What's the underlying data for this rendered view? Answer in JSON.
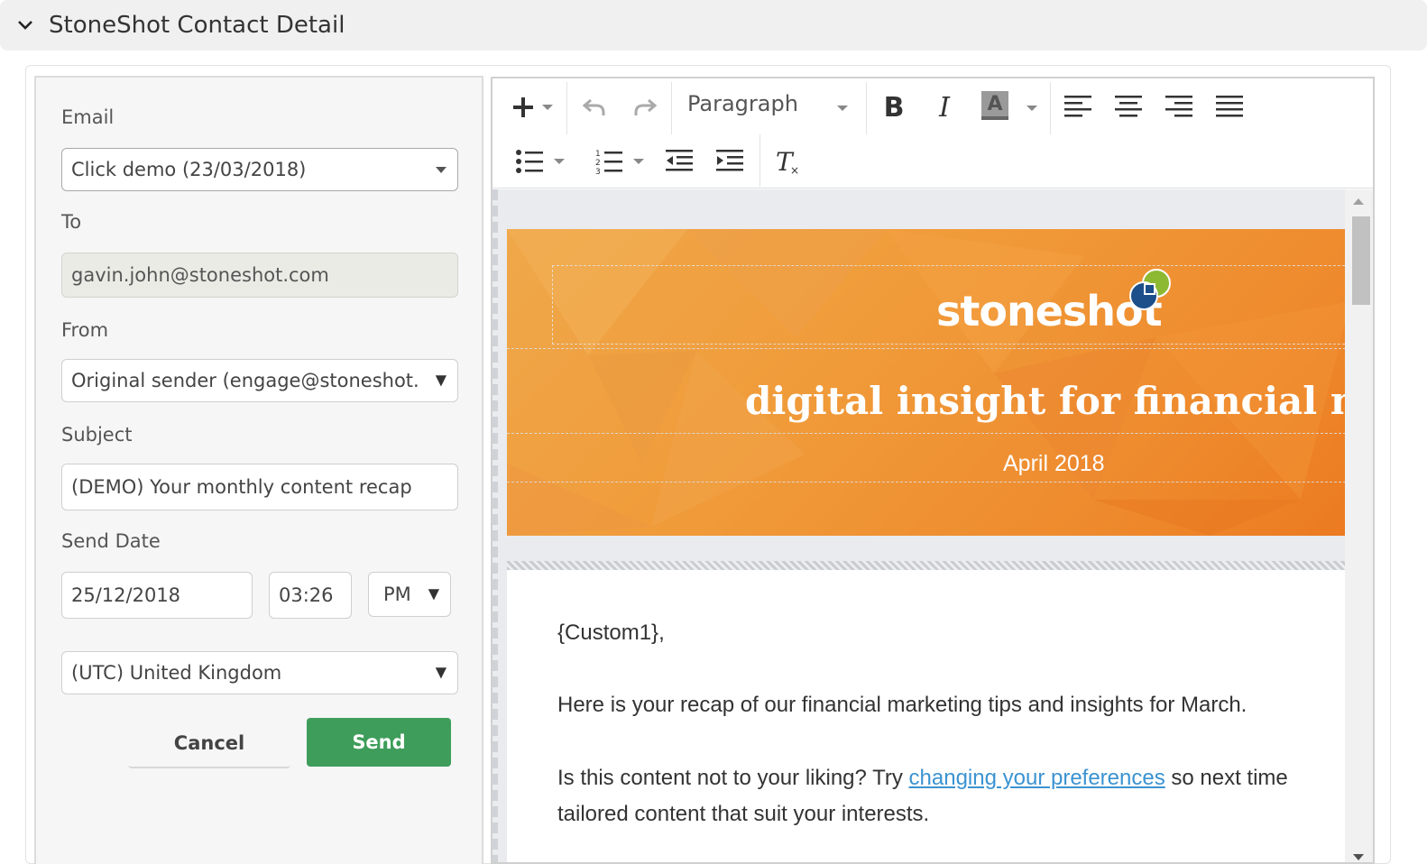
{
  "section": {
    "title": "StoneShot Contact Detail"
  },
  "form": {
    "email_label": "Email",
    "email_value": "Click demo (23/03/2018)",
    "to_label": "To",
    "to_value": "gavin.john@stoneshot.com",
    "from_label": "From",
    "from_value": "Original sender (engage@stoneshot.",
    "subject_label": "Subject",
    "subject_value": "(DEMO) Your monthly content recap",
    "send_date_label": "Send Date",
    "date_value": "25/12/2018",
    "time_value": "03:26",
    "ampm_value": "PM",
    "timezone_value": "(UTC) United Kingdom",
    "cancel_label": "Cancel",
    "send_label": "Send"
  },
  "toolbar": {
    "format_value": "Paragraph",
    "bold_label": "B",
    "italic_label": "I",
    "font_color_label": "A"
  },
  "banner": {
    "logo_text": "stoneshot",
    "title": "digital insight for financial marketers",
    "date": "April 2018"
  },
  "body": {
    "greeting": "{Custom1},",
    "line1": "Here is your recap of our financial marketing tips and insights for March.",
    "line2_before": "Is this content not to your liking? Try ",
    "line2_link": "changing your preferences",
    "line2_after": " so next time",
    "line3": "tailored content that suit your interests."
  },
  "colors": {
    "send_button": "#3f9d5b",
    "banner": "#f09b3a",
    "link": "#3b93d1"
  },
  "icons": [
    "chevron-down-icon",
    "plus-icon",
    "undo-icon",
    "redo-icon",
    "bold-icon",
    "italic-icon",
    "font-color-icon",
    "align-left-icon",
    "align-center-icon",
    "align-right-icon",
    "align-justify-icon",
    "bullet-list-icon",
    "numbered-list-icon",
    "outdent-icon",
    "indent-icon",
    "clear-format-icon"
  ]
}
